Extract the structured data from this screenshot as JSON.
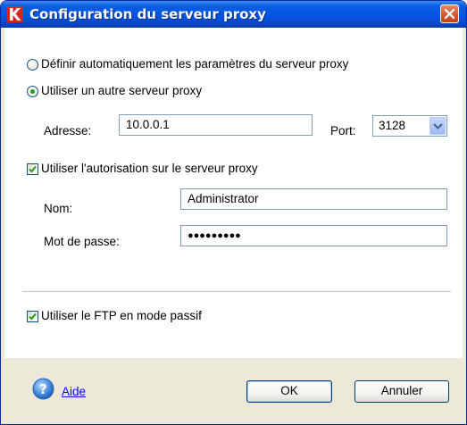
{
  "window": {
    "title": "Configuration du serveur proxy",
    "app_icon": "kaspersky-k-icon",
    "close_icon": "close-icon"
  },
  "options": {
    "auto_radio": {
      "label": "Définir automatiquement les paramètres du serveur proxy",
      "selected": false
    },
    "other_radio": {
      "label": "Utiliser un autre serveur proxy",
      "selected": true
    }
  },
  "address": {
    "label": "Adresse:",
    "value": "10.0.0.1",
    "port_label": "Port:",
    "port_value": "3128"
  },
  "auth": {
    "checkbox_label": "Utiliser l'autorisation sur le serveur proxy",
    "checked": true,
    "name_label": "Nom:",
    "name_value": "Administrator",
    "password_label": "Mot de passe:",
    "password_mask": "●●●●●●●●●"
  },
  "ftp": {
    "checkbox_label": "Utiliser le FTP en mode passif",
    "checked": true
  },
  "footer": {
    "help_label": "Aide",
    "help_icon": "help-icon",
    "ok_label": "OK",
    "cancel_label": "Annuler"
  },
  "colors": {
    "titlebar": "#0554e3",
    "dialog_face": "#ece9d8",
    "close_button": "#d65a3a",
    "link": "#0000ff"
  }
}
